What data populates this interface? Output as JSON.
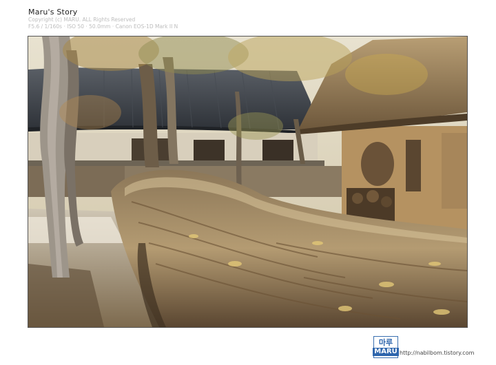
{
  "header": {
    "title": "Maru's Story",
    "copyright": "Copyright (c) MARU. ALL Rights Reserved",
    "exif": "F5.6 / 1/160s · ISO 50 · 50.0mm · Canon EOS-1D Mark II N"
  },
  "photo": {
    "subject": "traditional-hanok-courtyard"
  },
  "footer": {
    "logo_top": "마루",
    "logo_bottom": "MARU",
    "url": "http://nabilbom.tistory.com"
  },
  "colors": {
    "logo_blue": "#2f66ad",
    "frame_border": "#555555"
  }
}
